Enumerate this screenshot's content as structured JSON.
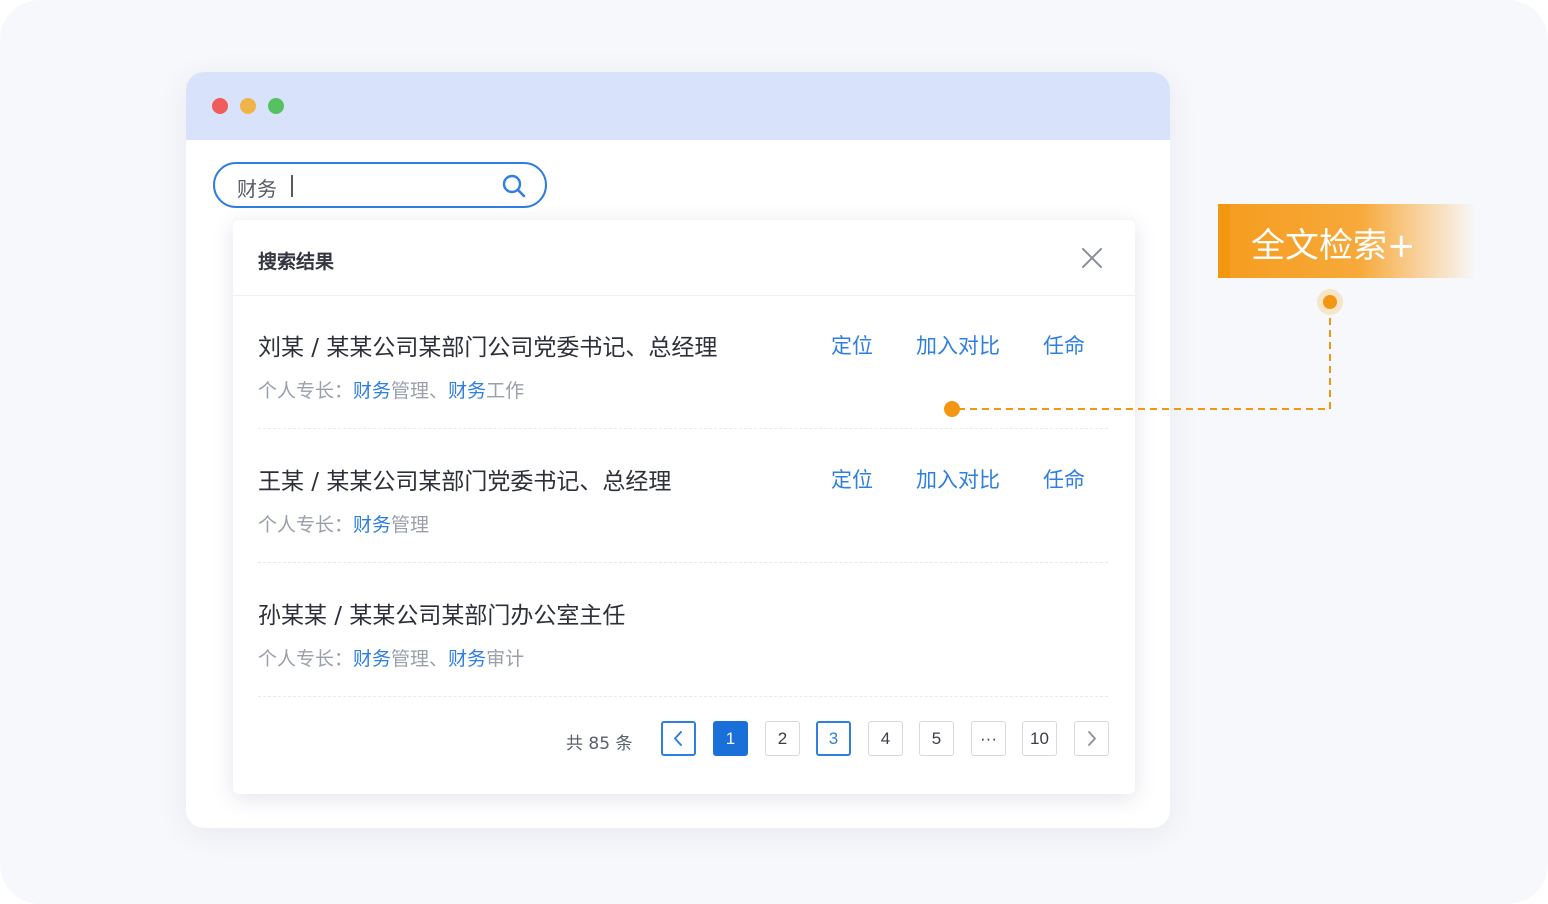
{
  "search": {
    "value": "财务"
  },
  "panel": {
    "title": "搜索结果",
    "results": [
      {
        "name": "刘某 / 某某公司某部门公司党委书记、总经理",
        "skills_label": "个人专长：",
        "skills": [
          {
            "hl": "财务",
            "rest": "管理"
          },
          {
            "hl": "财务",
            "rest": "工作"
          }
        ],
        "actions": [
          "定位",
          "加入对比",
          "任命"
        ]
      },
      {
        "name": "王某 / 某某公司某部门党委书记、总经理",
        "skills_label": "个人专长：",
        "skills": [
          {
            "hl": "财务",
            "rest": "管理"
          }
        ],
        "actions": [
          "定位",
          "加入对比",
          "任命"
        ]
      },
      {
        "name": "孙某某 / 某某公司某部门办公室主任",
        "skills_label": "个人专长：",
        "skills": [
          {
            "hl": "财务",
            "rest": "管理"
          },
          {
            "hl": "财务",
            "rest": "审计"
          }
        ],
        "actions": []
      }
    ],
    "pagination": {
      "total_text": "共 85 条",
      "pages": [
        "1",
        "2",
        "3",
        "4",
        "5",
        "···",
        "10"
      ],
      "current": "1",
      "focused": "3"
    }
  },
  "callout": {
    "label": "全文检索+"
  },
  "colors": {
    "accent": "#2f7fe0",
    "orange": "#f59c1e",
    "titlebar": "#d8e3fb",
    "dot_red": "#ee5c5c",
    "dot_yellow": "#f0b34a",
    "dot_green": "#56c161"
  },
  "icons": {
    "search": "search-icon",
    "close": "close-icon",
    "prev": "chevron-left-icon",
    "next": "chevron-right-icon"
  }
}
